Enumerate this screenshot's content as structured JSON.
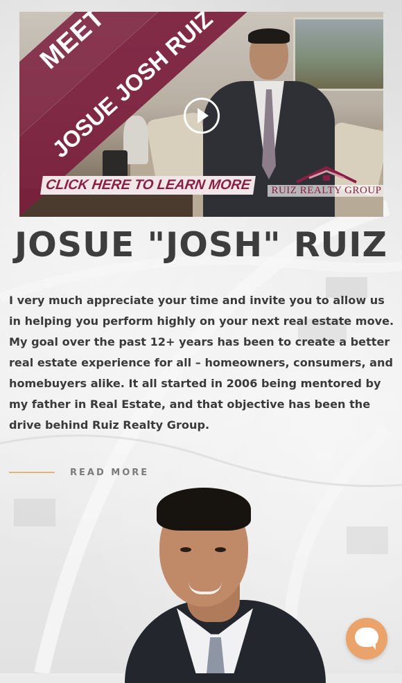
{
  "video": {
    "overlay_meet": "MEET",
    "overlay_name": "JOSUE JOSH RUIZ",
    "cta": "CLICK HERE TO LEARN MORE",
    "brand": "RUIZ REALTY GROUP",
    "play_icon": "play-icon"
  },
  "title": "JOSUE \"JOSH\" RUIZ",
  "intro": "I very much appreciate your time and invite you to allow us in helping you perform highly on your next real estate move. My goal over the past 12+ years has been to create a better real estate experience for all – homeowners, consumers, and homebuyers alike. It all started in 2006 being mentored by my father in Real Estate, and that objective has been the drive behind Ruiz Realty Group.",
  "read_more": "READ MORE",
  "chat": {
    "icon": "chat-bubble-icon"
  },
  "colors": {
    "accent_gold": "#e0b673",
    "brand_maroon": "#7c1f3e",
    "chat_orange": "#e9a36b",
    "heading": "#3d3d3d"
  }
}
